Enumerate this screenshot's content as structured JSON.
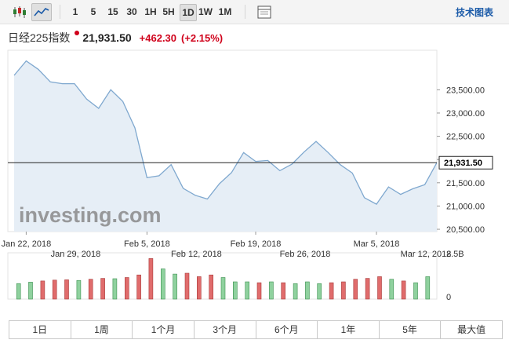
{
  "toolbar": {
    "intervals": [
      "1",
      "5",
      "15",
      "30",
      "1H",
      "5H",
      "1D",
      "1W",
      "1M"
    ],
    "active_interval": "1D",
    "icons": [
      "candlestick-icon",
      "line-chart-icon",
      "settings-panel-icon"
    ],
    "tools_label": "技术图表"
  },
  "header": {
    "name": "日经225指数",
    "price": "21,931.50",
    "change": "+462.30",
    "change_pct": "(+2.15%)",
    "accent_color": "#d0021b"
  },
  "chart_data": [
    {
      "type": "area",
      "x": [
        "2018-01-19",
        "2018-01-22",
        "2018-01-23",
        "2018-01-24",
        "2018-01-25",
        "2018-01-26",
        "2018-01-29",
        "2018-01-30",
        "2018-01-31",
        "2018-02-01",
        "2018-02-02",
        "2018-02-05",
        "2018-02-06",
        "2018-02-07",
        "2018-02-08",
        "2018-02-09",
        "2018-02-13",
        "2018-02-14",
        "2018-02-15",
        "2018-02-16",
        "2018-02-19",
        "2018-02-20",
        "2018-02-21",
        "2018-02-22",
        "2018-02-23",
        "2018-02-26",
        "2018-02-27",
        "2018-02-28",
        "2018-03-01",
        "2018-03-02",
        "2018-03-05",
        "2018-03-06",
        "2018-03-07",
        "2018-03-08",
        "2018-03-09",
        "2018-03-12"
      ],
      "values": [
        23810,
        24120,
        23940,
        23670,
        23630,
        23630,
        23300,
        23100,
        23500,
        23250,
        22680,
        21610,
        21650,
        21890,
        21380,
        21230,
        21150,
        21480,
        21720,
        22150,
        21960,
        21980,
        21760,
        21900,
        22160,
        22390,
        22150,
        21890,
        21710,
        21180,
        21040,
        21410,
        21250,
        21370,
        21460,
        21931.5
      ],
      "last_value": "21,931.50",
      "y_ticks": [
        "23,500.00",
        "23,000.00",
        "22,500.00",
        "22,000.00",
        "21,500.00",
        "21,000.00",
        "20,500.00"
      ],
      "ylim": [
        20450,
        24350
      ],
      "x_tick_labels_row1": [
        "Jan 22, 2018",
        "Feb 5, 2018",
        "Feb 19, 2018",
        "Mar 5, 2018"
      ],
      "x_tick_labels_row2": [
        "Jan 29, 2018",
        "Feb 12, 2018",
        "Feb 26, 2018",
        "Mar 12, 2018"
      ],
      "watermark": "investing.com",
      "line_color": "#7fa8cf",
      "fill_color": "#e6eef6"
    },
    {
      "type": "bar",
      "name": "volume",
      "values": [
        0.9,
        0.98,
        1.05,
        1.1,
        1.12,
        1.08,
        1.15,
        1.2,
        1.18,
        1.25,
        1.4,
        2.35,
        1.75,
        1.45,
        1.5,
        1.3,
        1.4,
        1.25,
        1.0,
        1.0,
        0.95,
        1.0,
        0.95,
        0.9,
        1.0,
        0.9,
        0.95,
        1.0,
        1.15,
        1.2,
        1.3,
        1.15,
        1.05,
        0.95,
        1.3
      ],
      "directions": [
        "up",
        "up",
        "down",
        "down",
        "down",
        "up",
        "down",
        "down",
        "up",
        "down",
        "down",
        "down",
        "up",
        "up",
        "down",
        "down",
        "down",
        "up",
        "up",
        "up",
        "down",
        "up",
        "down",
        "up",
        "up",
        "up",
        "down",
        "down",
        "down",
        "down",
        "down",
        "up",
        "down",
        "up",
        "up"
      ],
      "y_ticks": [
        "2.5B",
        "0"
      ],
      "ylim": [
        0,
        2.5
      ],
      "up_color": "#8fd19e",
      "down_color": "#e06c6c"
    }
  ],
  "ranges": [
    "1日",
    "1周",
    "1个月",
    "3个月",
    "6个月",
    "1年",
    "5年",
    "最大值"
  ]
}
